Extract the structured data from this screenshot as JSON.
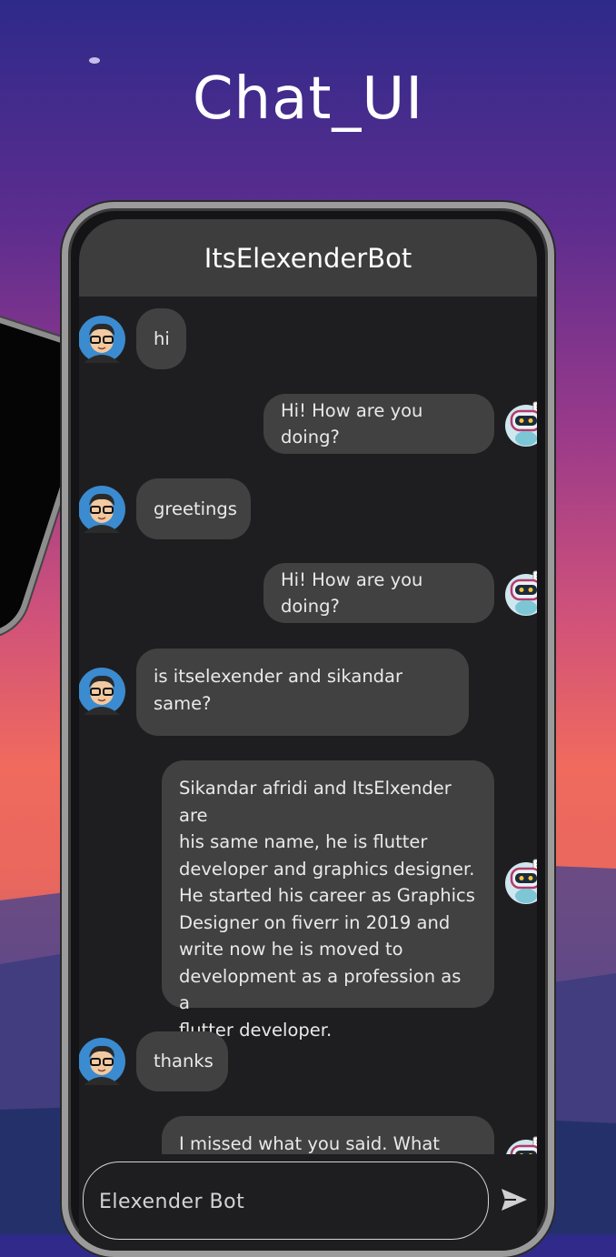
{
  "page": {
    "title": "Chat_UI"
  },
  "colors": {
    "app_bar": "#3d3d3d",
    "bubble": "#414141",
    "screen": "#1e1e20"
  },
  "chat": {
    "header_title": "ItsElexenderBot",
    "messages": [
      {
        "sender": "user",
        "text": "hi"
      },
      {
        "sender": "bot",
        "text": "Hi! How are you doing?"
      },
      {
        "sender": "user",
        "text": "greetings"
      },
      {
        "sender": "bot",
        "text": "Hi! How are you doing?"
      },
      {
        "sender": "user",
        "lines": [
          "is itselexender and sikandar",
          "same?"
        ]
      },
      {
        "sender": "bot",
        "lines": [
          "Sikandar afridi and ItsElxender are",
          "his same name, he is flutter",
          "developer and graphics designer.",
          "He started his career as Graphics",
          "Designer on fiverr in 2019 and",
          "write now he is moved to",
          "development as a profession as a",
          "flutter developer."
        ]
      },
      {
        "sender": "user",
        "text": "thanks"
      },
      {
        "sender": "bot",
        "text": "I missed what you said. What was"
      }
    ],
    "input": {
      "placeholder": "Elexender Bot",
      "value": ""
    },
    "send_icon": "send-icon",
    "user_avatar_icon": "user-avatar-icon",
    "bot_avatar_icon": "bot-avatar-icon"
  }
}
